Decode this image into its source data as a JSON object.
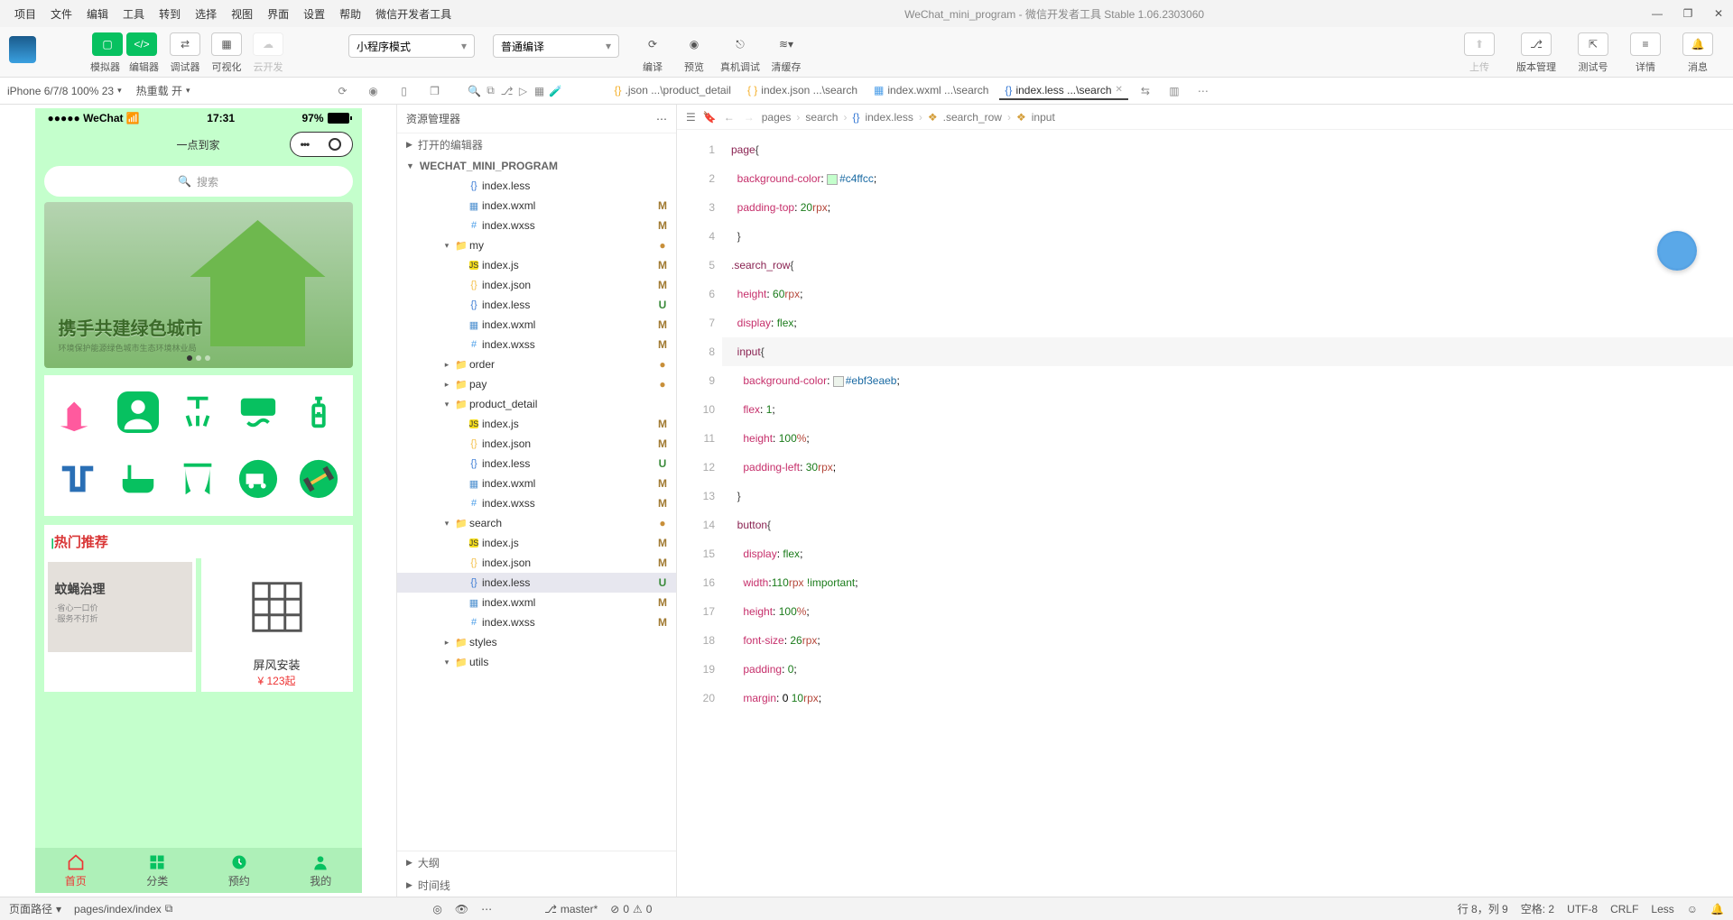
{
  "menubar": {
    "items": [
      "项目",
      "文件",
      "编辑",
      "工具",
      "转到",
      "选择",
      "视图",
      "界面",
      "设置",
      "帮助",
      "微信开发者工具"
    ],
    "title": "WeChat_mini_program - 微信开发者工具 Stable 1.06.2303060"
  },
  "toolbar": {
    "labels": [
      "模拟器",
      "编辑器",
      "调试器",
      "可视化",
      "云开发"
    ],
    "select1": "小程序模式",
    "select2": "普通编译",
    "right_labels": [
      "编译",
      "预览",
      "真机调试",
      "清缓存"
    ],
    "far_labels": [
      "上传",
      "版本管理",
      "测试号",
      "详情",
      "消息"
    ]
  },
  "secondbar": {
    "device": "iPhone 6/7/8 100% 23",
    "hot": "热重载 开",
    "tabs": [
      {
        "icon": "{}",
        "name": ".json ...\\product_detail"
      },
      {
        "icon": "{ }",
        "name": "index.json ...\\search"
      },
      {
        "icon": "▦",
        "name": "index.wxml ...\\search"
      },
      {
        "icon": "{}",
        "name": "index.less ...\\search",
        "active": true
      }
    ]
  },
  "simulator": {
    "status_left": "●●●●● WeChat",
    "time": "17:31",
    "battery": "97%",
    "app_title": "一点到家",
    "search_placeholder": "搜索",
    "hero_title": "携手共建绿色城市",
    "hero_sub": "环境保护能源绿色城市生态环境林业局",
    "section": "|热门推荐",
    "products": [
      {
        "name": "蚊蝇治理",
        "sub1": "·省心一口价",
        "sub2": "·服务不打折"
      },
      {
        "name": "屏风安装",
        "price": "¥ 123起"
      }
    ],
    "tabbar": [
      "首页",
      "分类",
      "预约",
      "我的"
    ]
  },
  "explorer": {
    "title": "资源管理器",
    "opened": "打开的编辑器",
    "project": "WECHAT_MINI_PROGRAM",
    "tree": [
      {
        "d": 3,
        "ic": "less",
        "nm": "index.less",
        "st": ""
      },
      {
        "d": 3,
        "ic": "wxml",
        "nm": "index.wxml",
        "st": "M"
      },
      {
        "d": 3,
        "ic": "wxss",
        "nm": "index.wxss",
        "st": "M"
      },
      {
        "d": 2,
        "ic": "folder",
        "nm": "my",
        "st": "dot",
        "exp": true
      },
      {
        "d": 3,
        "ic": "js",
        "nm": "index.js",
        "st": "M"
      },
      {
        "d": 3,
        "ic": "json",
        "nm": "index.json",
        "st": "M"
      },
      {
        "d": 3,
        "ic": "less",
        "nm": "index.less",
        "st": "U"
      },
      {
        "d": 3,
        "ic": "wxml",
        "nm": "index.wxml",
        "st": "M"
      },
      {
        "d": 3,
        "ic": "wxss",
        "nm": "index.wxss",
        "st": "M"
      },
      {
        "d": 2,
        "ic": "folder",
        "nm": "order",
        "st": "dot",
        "exp": false
      },
      {
        "d": 2,
        "ic": "folder",
        "nm": "pay",
        "st": "dot",
        "exp": false
      },
      {
        "d": 2,
        "ic": "folder",
        "nm": "product_detail",
        "st": "",
        "exp": true
      },
      {
        "d": 3,
        "ic": "js",
        "nm": "index.js",
        "st": "M"
      },
      {
        "d": 3,
        "ic": "json",
        "nm": "index.json",
        "st": "M"
      },
      {
        "d": 3,
        "ic": "less",
        "nm": "index.less",
        "st": "U"
      },
      {
        "d": 3,
        "ic": "wxml",
        "nm": "index.wxml",
        "st": "M"
      },
      {
        "d": 3,
        "ic": "wxss",
        "nm": "index.wxss",
        "st": "M"
      },
      {
        "d": 2,
        "ic": "folder",
        "nm": "search",
        "st": "dot",
        "exp": true
      },
      {
        "d": 3,
        "ic": "js",
        "nm": "index.js",
        "st": "M"
      },
      {
        "d": 3,
        "ic": "json",
        "nm": "index.json",
        "st": "M"
      },
      {
        "d": 3,
        "ic": "less",
        "nm": "index.less",
        "st": "U",
        "sel": true
      },
      {
        "d": 3,
        "ic": "wxml",
        "nm": "index.wxml",
        "st": "M"
      },
      {
        "d": 3,
        "ic": "wxss",
        "nm": "index.wxss",
        "st": "M"
      },
      {
        "d": 2,
        "ic": "folder",
        "nm": "styles",
        "st": "",
        "exp": false,
        "blue": true
      },
      {
        "d": 2,
        "ic": "folder",
        "nm": "utils",
        "st": "",
        "exp": true,
        "green": true
      }
    ],
    "outline": "大纲",
    "timeline": "时间线"
  },
  "breadcrumb": {
    "items": [
      "pages",
      "search",
      "index.less",
      ".search_row",
      "input"
    ]
  },
  "code": [
    "page{",
    "  background-color: ▢#c4ffcc;",
    "  padding-top: 20rpx;",
    "  }",
    ".search_row{",
    "  height: 60rpx;",
    "  display: flex;",
    "  input{",
    "    background-color: ▢#ebf3eaeb;",
    "    flex:1;",
    "    height: 100%;",
    "    padding-left: 30rpx;",
    "  }",
    "  button{",
    "    display:flex;",
    "    width:110rpx !important;",
    "    height: 100%;",
    "    font-size: 26rpx;",
    "    padding: 0;",
    "    margin: 0 10rpx;"
  ],
  "status": {
    "left_label": "页面路径",
    "left_path": "pages/index/index",
    "branch": "master*",
    "errors": "0",
    "warnings": "0",
    "pos": "行 8，列 9",
    "spaces": "空格: 2",
    "enc": "UTF-8",
    "eol": "CRLF",
    "lang": "Less"
  }
}
